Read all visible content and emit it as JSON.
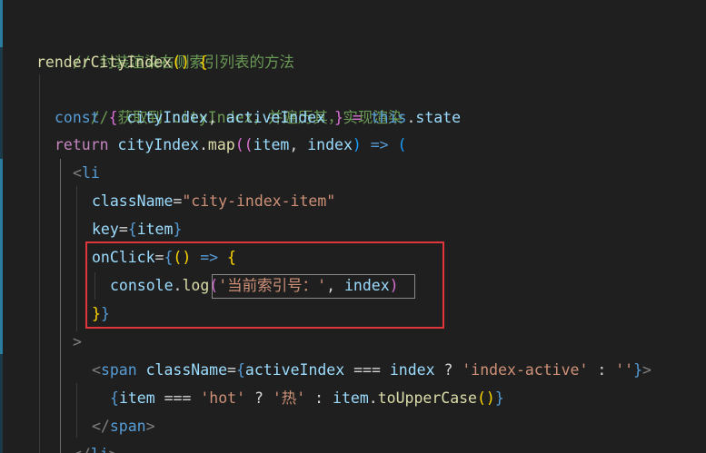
{
  "code": {
    "line1": {
      "comment": "// 封装渲染右侧索引列表的方法"
    },
    "line2": {
      "fn": "renderCityIndex",
      "parens": "()",
      "brace": " {"
    },
    "line3": {
      "comment": "// 获取到 cityIndex，并遍历其，实现渲染"
    },
    "line4": {
      "kw": "const",
      "open": " { ",
      "v1": "cityIndex",
      "comma": ", ",
      "v2": "activeIndex",
      "close": " } = ",
      "this": "this",
      "dot": ".",
      "state": "state"
    },
    "line5": {
      "kw": "return",
      "sp": " ",
      "obj": "cityIndex",
      "dot": ".",
      "fn": "map",
      "p1": "((",
      "a1": "item",
      "c1": ", ",
      "a2": "index",
      "p2": ") ",
      "arrow": "=>",
      "p3": " ("
    },
    "line6": {
      "lt": "<",
      "tag": "li"
    },
    "line7": {
      "attr": "className",
      "eq": "=",
      "str": "\"city-index-item\""
    },
    "line8": {
      "attr": "key",
      "eq": "=",
      "ob": "{",
      "v": "item",
      "cb": "}"
    },
    "line9": {
      "attr": "onClick",
      "eq": "=",
      "ob": "{",
      "p": "()",
      "arrow": " => ",
      "brace": "{"
    },
    "line10": {
      "obj": "console",
      "dot": ".",
      "fn": "log",
      "op": "(",
      "str": "'当前索引号：'",
      "comma": ", ",
      "v": "index",
      "cp": ")"
    },
    "line11": {
      "cb1": "}",
      "cb2": "}"
    },
    "line12": {
      "gt": ">"
    },
    "line13": {
      "lt": "<",
      "tag": "span",
      "sp": " ",
      "attr": "className",
      "eq": "=",
      "ob": "{",
      "v1": "activeIndex",
      "op": " === ",
      "v2": "index",
      "q": " ? ",
      "s1": "'index-active'",
      "colon": " : ",
      "s2": "''",
      "cb": "}",
      "gt": ">"
    },
    "line14": {
      "ob": "{",
      "v1": "item",
      "op": " === ",
      "s1": "'hot'",
      "q": " ? ",
      "s2": "'热'",
      "colon": " : ",
      "v2": "item",
      "dot": ".",
      "fn": "toUpperCase",
      "p": "()",
      "cb": "}"
    },
    "line15": {
      "lt": "</",
      "tag": "span",
      "gt": ">"
    },
    "line16": {
      "lt": "</",
      "tag": "li",
      "gt": ">"
    }
  },
  "colors": {
    "background": "#1f1f1f",
    "highlight_box": "#e0353b"
  }
}
